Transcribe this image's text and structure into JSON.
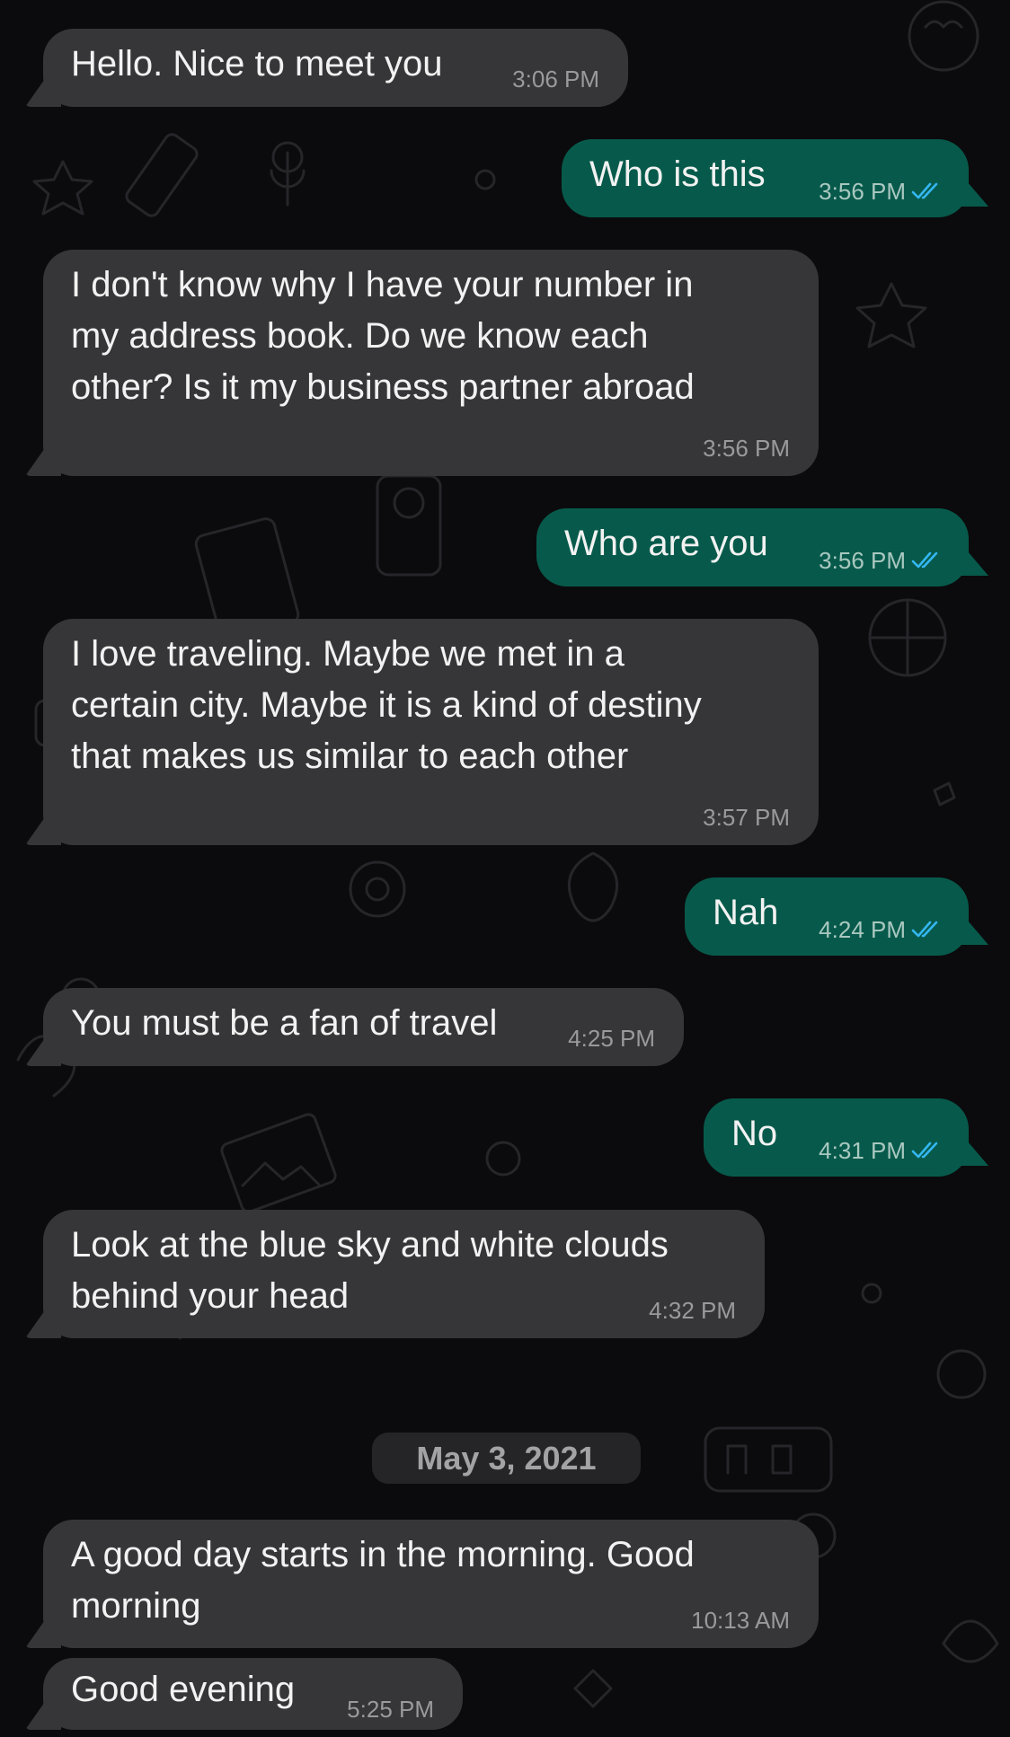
{
  "colors": {
    "background": "#0b0b0d",
    "incoming_bubble": "#363638",
    "outgoing_bubble": "#075a4b",
    "read_ticks": "#34b7f1"
  },
  "messages": [
    {
      "text": "Hello. Nice to meet you",
      "time": "3:06 PM",
      "direction": "incoming"
    },
    {
      "text": "Who is this",
      "time": "3:56 PM",
      "direction": "outgoing",
      "status": "read"
    },
    {
      "text": "I don't know why I have your number in\nmy address book. Do we know each\nother? Is it my business partner abroad",
      "time": "3:56 PM",
      "direction": "incoming"
    },
    {
      "text": "Who are you",
      "time": "3:56 PM",
      "direction": "outgoing",
      "status": "read"
    },
    {
      "text": "I love traveling. Maybe we met in a\ncertain city. Maybe it is a kind of destiny\nthat makes us similar to each other",
      "time": "3:57 PM",
      "direction": "incoming"
    },
    {
      "text": "Nah",
      "time": "4:24 PM",
      "direction": "outgoing",
      "status": "read"
    },
    {
      "text": "You must be a fan of travel",
      "time": "4:25 PM",
      "direction": "incoming"
    },
    {
      "text": "No",
      "time": "4:31 PM",
      "direction": "outgoing",
      "status": "read"
    },
    {
      "text": "Look at the blue sky and white clouds\nbehind your head",
      "time": "4:32 PM",
      "direction": "incoming"
    },
    {
      "text": "A good day starts in the morning. Good\nmorning",
      "time": "10:13 AM",
      "direction": "incoming"
    },
    {
      "text": "Good evening",
      "time": "5:25 PM",
      "direction": "incoming"
    }
  ],
  "date_divider": "May 3, 2021"
}
